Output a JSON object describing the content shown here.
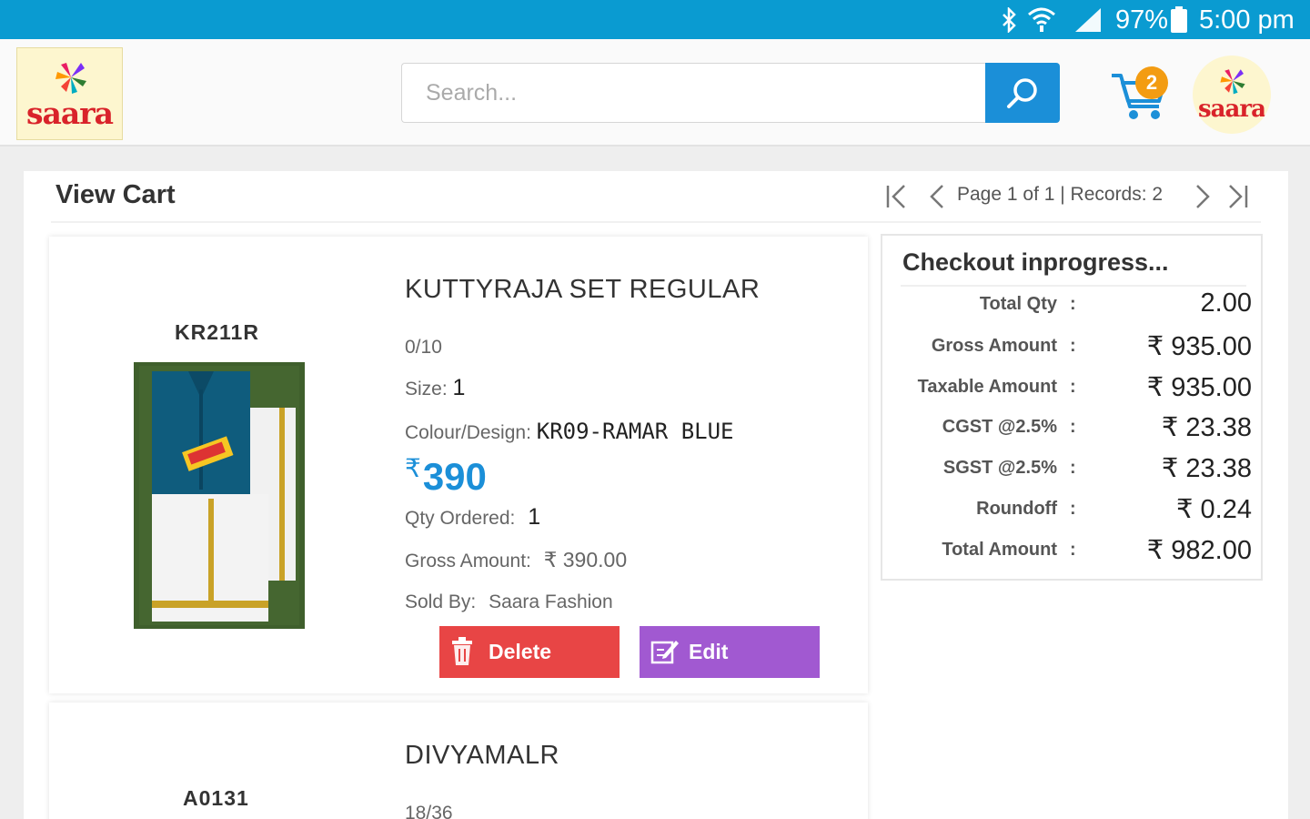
{
  "status_bar": {
    "battery": "97%",
    "time": "5:00 pm"
  },
  "header": {
    "logo_text": "saara",
    "search_placeholder": "Search...",
    "cart_count": "2",
    "avatar_text": "saara"
  },
  "page": {
    "title": "View Cart",
    "pager_text": "Page 1 of 1 | Records: 2"
  },
  "items": [
    {
      "code": "KR211R",
      "name": "KUTTYRAJA SET REGULAR",
      "size_range": "0/10",
      "size_label": "Size:",
      "size_value": "1",
      "colour_label": "Colour/Design:",
      "colour_value": "KR09-RAMAR BLUE",
      "price_symbol": "₹",
      "price": "390",
      "qty_label": "Qty Ordered:",
      "qty_value": "1",
      "gross_label": "Gross Amount:",
      "gross_value": "₹ 390.00",
      "sold_label": "Sold By:",
      "sold_value": "Saara Fashion",
      "delete_label": "Delete",
      "edit_label": "Edit"
    },
    {
      "code": "A0131",
      "name": "DIVYAMALR",
      "size_range": "18/36"
    }
  ],
  "summary": {
    "title": "Checkout inprogress...",
    "rows": [
      {
        "label": "Total Qty",
        "value": "2.00"
      },
      {
        "label": "Gross Amount",
        "value": "₹ 935.00"
      },
      {
        "label": "Taxable Amount",
        "value": "₹ 935.00"
      },
      {
        "label": "CGST @2.5%",
        "value": "₹ 23.38"
      },
      {
        "label": "SGST @2.5%",
        "value": "₹ 23.38"
      },
      {
        "label": "Roundoff",
        "value": "₹ 0.24"
      },
      {
        "label": "Total Amount",
        "value": "₹ 982.00"
      }
    ],
    "colon": ":"
  },
  "colors": {
    "status_bar": "#0a9bd1",
    "accent": "#1b8fd8",
    "delete": "#e84545",
    "edit": "#a159d1",
    "badge": "#f39c12"
  },
  "icons": [
    "bluetooth-icon",
    "wifi-icon",
    "signal-icon",
    "battery-icon",
    "search-icon",
    "cart-icon",
    "first-page-icon",
    "prev-page-icon",
    "next-page-icon",
    "last-page-icon",
    "trash-icon",
    "edit-icon"
  ]
}
